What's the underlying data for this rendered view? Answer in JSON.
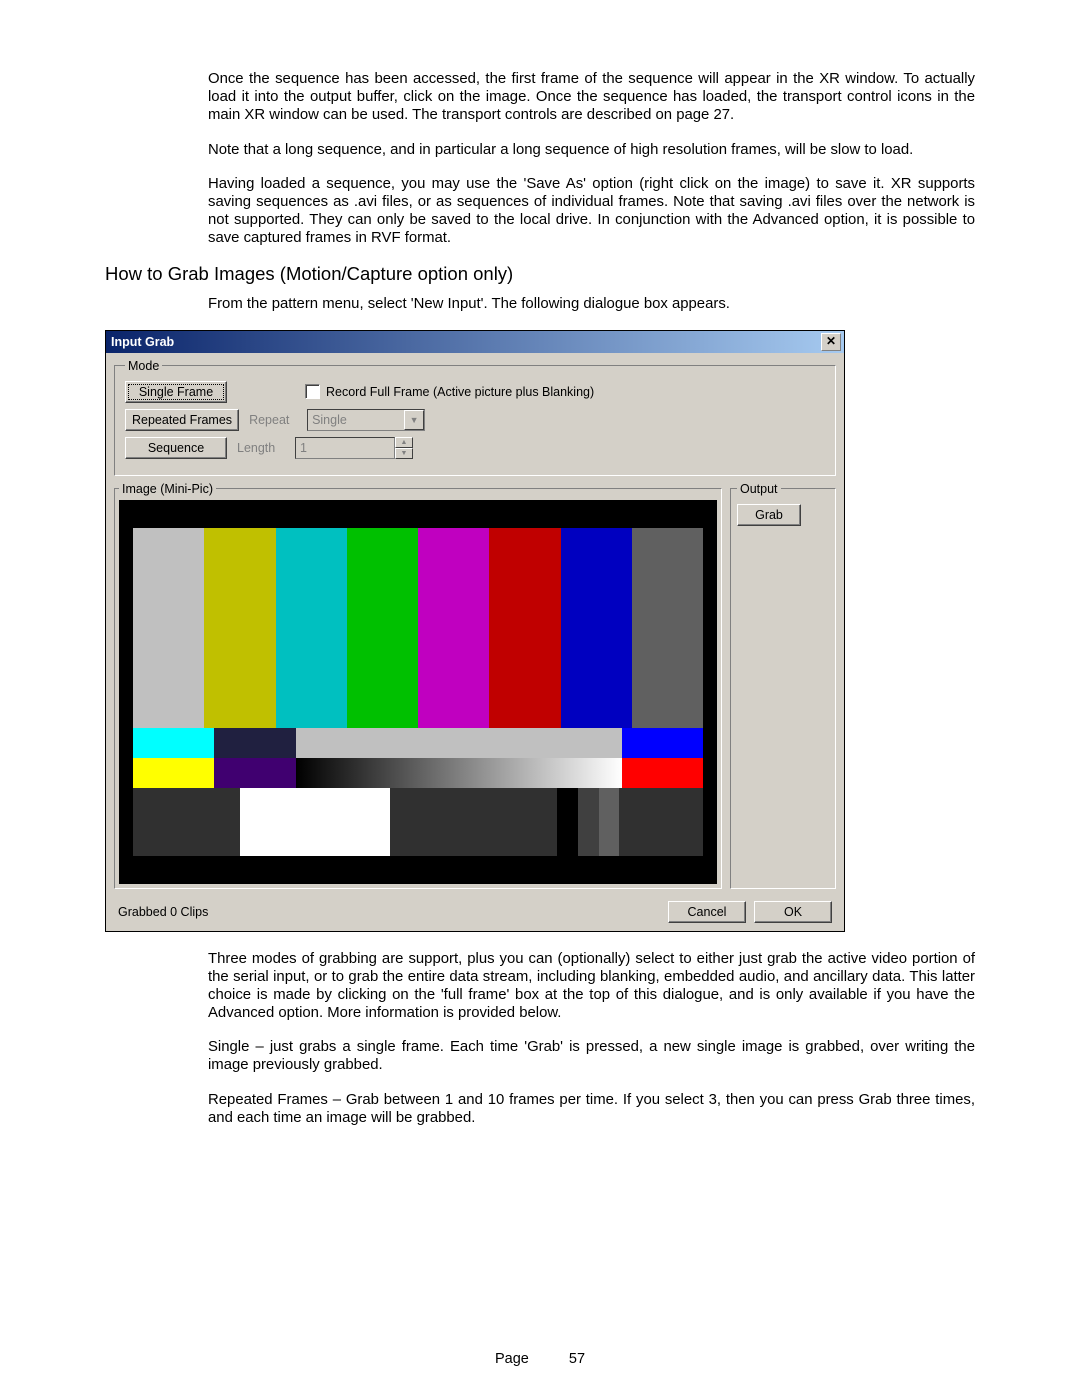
{
  "paragraphs": {
    "p1": "Once the sequence has been accessed, the first frame of the sequence will appear in the XR window.  To actually load it into the output buffer, click on the image.  Once the sequence has loaded, the transport control icons in the main XR window can be used.  The transport controls are described on page 27.",
    "p2": "Note that a long sequence, and in particular a long sequence of high resolution frames, will be slow to load.",
    "p3": "Having loaded a sequence, you may use the 'Save As' option (right click on the image) to save it.  XR supports saving sequences as .avi files, or as sequences of individual frames.  Note that saving .avi files over the network is not supported.  They can only be saved to the local drive.  In conjunction with the Advanced option, it is possible to save captured frames in RVF format.",
    "heading": "How to Grab Images (Motion/Capture option only)",
    "p4": "From the pattern menu, select 'New Input'.  The following dialogue box appears.",
    "p5": "Three modes of grabbing are support, plus you can (optionally) select to either just grab the active video portion of the serial input, or to grab the entire data stream, including blanking, embedded audio, and ancillary data.  This latter choice is made by clicking on the 'full frame' box at the top of this dialogue, and is only available if you have the Advanced option.  More information is provided below.",
    "p6": "Single – just grabs a single frame.  Each time 'Grab' is pressed, a new single image is grabbed, over writing the image previously grabbed.",
    "p7": "Repeated Frames – Grab between 1 and 10 frames per time.  If you select 3, then you can press Grab three times, and each time an image will be grabbed."
  },
  "dialog": {
    "title": "Input Grab",
    "mode_legend": "Mode",
    "btn_single": "Single Frame",
    "btn_repeated": "Repeated Frames",
    "btn_sequence": "Sequence",
    "record_full": "Record Full Frame (Active picture plus Blanking)",
    "label_repeat": "Repeat",
    "label_length": "Length",
    "combo_value": "Single",
    "spinner_value": "1",
    "image_legend": "Image (Mini-Pic)",
    "output_legend": "Output",
    "btn_grab": "Grab",
    "status": "Grabbed 0 Clips",
    "btn_cancel": "Cancel",
    "btn_ok": "OK"
  },
  "footer": {
    "label": "Page",
    "number": "57"
  }
}
